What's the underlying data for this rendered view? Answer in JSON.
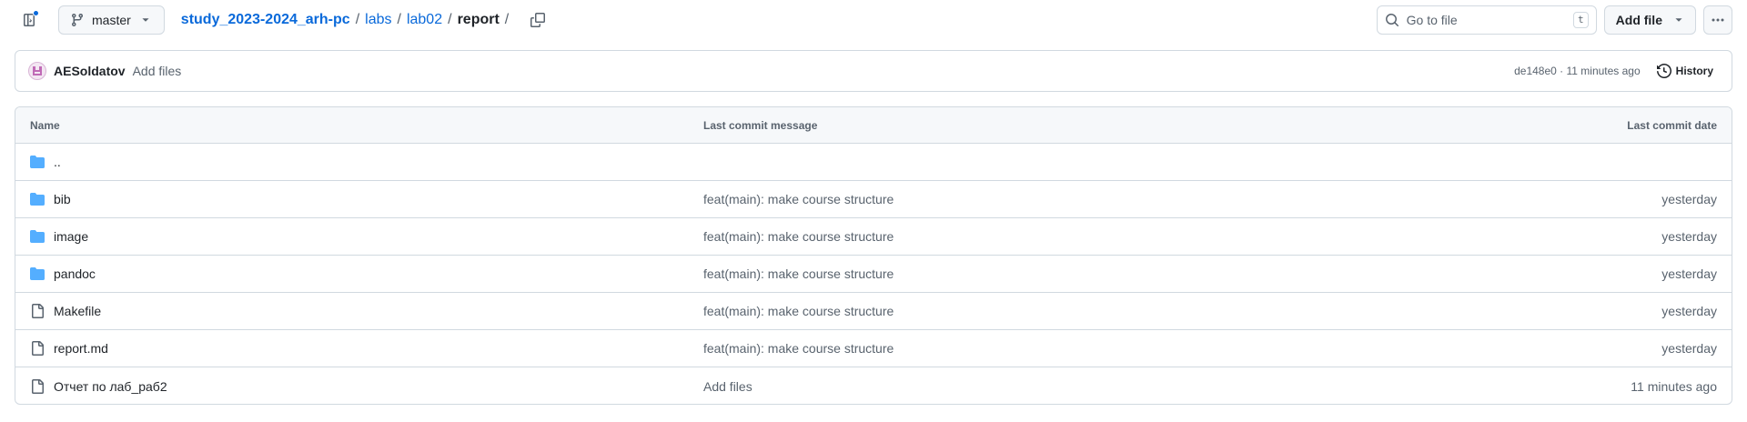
{
  "topbar": {
    "branch": "master",
    "breadcrumb": {
      "repo": "study_2023-2024_arh-pc",
      "sep1": "/",
      "part1": "labs",
      "sep2": "/",
      "part2": "lab02",
      "sep3": "/",
      "current": "report",
      "sep4": "/"
    },
    "goto_placeholder": "Go to file",
    "goto_shortcut": "t",
    "add_file_label": "Add file"
  },
  "commit": {
    "author": "AESoldatov",
    "message": "Add files",
    "meta": "de148e0 · 11 minutes ago",
    "history_label": "History"
  },
  "table": {
    "headers": {
      "name": "Name",
      "message": "Last commit message",
      "date": "Last commit date"
    },
    "rows": [
      {
        "type": "folder",
        "name": "..",
        "message": "",
        "date": ""
      },
      {
        "type": "folder",
        "name": "bib",
        "message": "feat(main): make course structure",
        "date": "yesterday"
      },
      {
        "type": "folder",
        "name": "image",
        "message": "feat(main): make course structure",
        "date": "yesterday"
      },
      {
        "type": "folder",
        "name": "pandoc",
        "message": "feat(main): make course structure",
        "date": "yesterday"
      },
      {
        "type": "file",
        "name": "Makefile",
        "message": "feat(main): make course structure",
        "date": "yesterday"
      },
      {
        "type": "file",
        "name": "report.md",
        "message": "feat(main): make course structure",
        "date": "yesterday"
      },
      {
        "type": "file",
        "name": "Отчет по лаб_раб2",
        "message": "Add files",
        "date": "11 minutes ago"
      }
    ]
  },
  "colors": {
    "link": "#0969da",
    "folder_icon": "#54aeff",
    "muted": "#59636e",
    "border": "#d1d9e0"
  },
  "icons": {
    "sidebar": "sidebar-expand-icon",
    "branch": "git-branch-icon",
    "copy": "copy-icon",
    "search": "search-icon",
    "caret": "triangle-down-icon",
    "kebab": "kebab-horizontal-icon",
    "history": "history-icon",
    "folder": "folder-icon",
    "file": "file-icon"
  }
}
